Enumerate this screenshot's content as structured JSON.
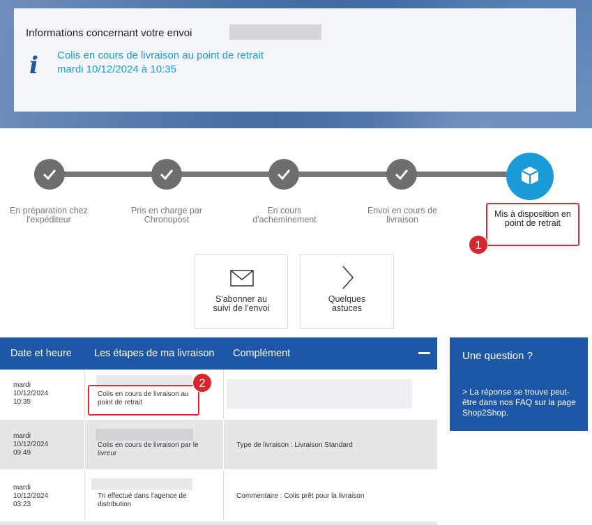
{
  "info": {
    "title": "Informations concernant votre envoi",
    "status_line1": "Colis en cours de livraison au point de retrait",
    "status_line2": "mardi 10/12/2024 à 10:35",
    "icon": "info-icon"
  },
  "steps": [
    {
      "label": "En préparation chez l'expéditeur",
      "state": "done"
    },
    {
      "label": "Pris en charge par Chronopost",
      "state": "done"
    },
    {
      "label": "En cours d'acheminement",
      "state": "done"
    },
    {
      "label": "Envoi en cours de livraison",
      "state": "done"
    },
    {
      "label": "Mis à disposition en point de retrait",
      "state": "active"
    }
  ],
  "colors": {
    "brand_blue": "#1e57a7",
    "accent_cyan": "#1a9bd7",
    "done_gray": "#6e6e70",
    "highlight_red": "#e02a35"
  },
  "badges": {
    "one": "1",
    "two": "2"
  },
  "actions": {
    "subscribe": {
      "label": "S'abonner au suivi de l'envoi",
      "icon": "envelope-icon"
    },
    "tips": {
      "label": "Quelques astuces",
      "icon": "chevron-right-icon"
    }
  },
  "table": {
    "headers": [
      "Date et heure",
      "Les étapes de ma livraison",
      "Complément"
    ],
    "rows": [
      {
        "day": "mardi",
        "date": "10/12/2024",
        "time": "10:35",
        "step": "Colis en cours de livraison au point de retrait",
        "complement": ""
      },
      {
        "day": "mardi",
        "date": "10/12/2024",
        "time": "09:49",
        "step": "Colis en cours de livraison par le livreur",
        "complement": "Type de livraison : Livraison Standard"
      },
      {
        "day": "mardi",
        "date": "10/12/2024",
        "time": "03:23",
        "step": "Tri effectué dans l'agence de distribution",
        "complement": "Commentaire : Colis prêt pour la livraison"
      }
    ]
  },
  "question": {
    "title": "Une question ?",
    "body": "> La réponse se trouve peut-être dans nos FAQ sur la page Shop2Shop."
  }
}
